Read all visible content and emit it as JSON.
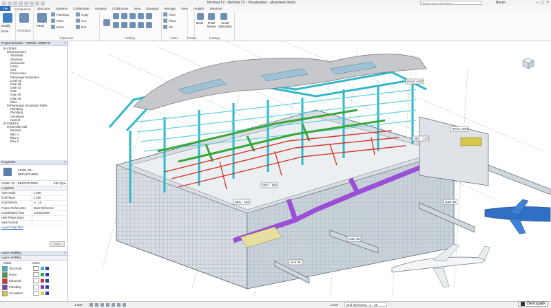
{
  "window": {
    "title": "Terminal T2 - Mumbai T2 - Visualization - (Autodesk Revit)",
    "search_placeholder": "Search and in Formation",
    "user": "Baven"
  },
  "ribbon_tabs": [
    "File",
    "Architecture",
    "Structure",
    "Systems",
    "Collaborate",
    "Analysis",
    "Collaborate",
    "View",
    "Dimapps",
    "Manage",
    "View",
    "Analytic",
    "Measure"
  ],
  "ribbon": {
    "select": {
      "label": "Select",
      "big": "Modify",
      "mode": "None"
    },
    "animation": "Animation",
    "clipboard": {
      "label": "Clipboard",
      "paste": "Paste",
      "items": [
        "Flamingo",
        "Parts",
        "Move"
      ],
      "items2": [
        "Copy",
        "Cut",
        "Exit"
      ]
    },
    "editing": {
      "label": "Editing"
    },
    "video": {
      "label": "Video",
      "items": [
        "View",
        "Place",
        "3D"
      ]
    },
    "relate": {
      "label": "Relate"
    },
    "catalog": {
      "label": "Catalog",
      "items": [
        "Mode",
        "Flash Resize",
        "Smart Maintenity"
      ]
    }
  },
  "project_browser": {
    "title": "Project Browser - VIEWS, SHEETS",
    "nodes": [
      {
        "text": "VIEWS",
        "indent": 1
      },
      {
        "text": "Concourses",
        "indent": 2
      },
      {
        "text": "Structural",
        "indent": 3
      },
      {
        "text": "Structure",
        "indent": 3
      },
      {
        "text": "Concourse",
        "indent": 3
      },
      {
        "text": "HVAC",
        "indent": 3
      },
      {
        "text": "NST",
        "indent": 3
      },
      {
        "text": "Concourses",
        "indent": 3
      },
      {
        "text": "Passenger Movement",
        "indent": 3
      },
      {
        "text": "Level 02",
        "indent": 3
      },
      {
        "text": "Gate 45",
        "indent": 3
      },
      {
        "text": "Gate 43",
        "indent": 3
      },
      {
        "text": "Gate",
        "indent": 3
      },
      {
        "text": "Gate 45",
        "indent": 3
      },
      {
        "text": "Gate 45",
        "indent": 3
      },
      {
        "text": "Pass",
        "indent": 3
      },
      {
        "text": "Passenger Movement Paths",
        "indent": 2
      },
      {
        "text": "Plumbing",
        "indent": 3
      },
      {
        "text": "Plumbing",
        "indent": 3
      },
      {
        "text": "Circulation",
        "indent": 3
      },
      {
        "text": "Current",
        "indent": 3
      },
      {
        "text": "SHEETS",
        "indent": 1
      },
      {
        "text": "Checkin Hall",
        "indent": 2
      },
      {
        "text": "Borneat",
        "indent": 3
      },
      {
        "text": "Bato 1",
        "indent": 3
      },
      {
        "text": "Elev 2",
        "indent": 3
      },
      {
        "text": "Elev 3",
        "indent": 3
      }
    ]
  },
  "properties": {
    "title": "Properties",
    "type_line1": "LEVEL 02 -",
    "type_line2": "DEPARTURES",
    "instance": "LEVEL 02 - DEPARTURES",
    "edit_type": "Edit Type",
    "section": "Legalities",
    "rows": [
      {
        "k": "View Scale",
        "v": "1:200"
      },
      {
        "k": "Grid Ratus",
        "v": "1:200"
      },
      {
        "k": "Grid Referar",
        "v": "A - 18"
      },
      {
        "k": "Project Referenzes",
        "v": "Dont Reference"
      },
      {
        "k": "Coordinated View",
        "v": "Construction"
      },
      {
        "k": "Hide Phase Dues",
        "v": ""
      },
      {
        "k": "View Society",
        "v": ""
      }
    ],
    "help": "Layout Help 3fes",
    "apply": "Apply"
  },
  "layer_visibility": {
    "title1": "Layer Visibility",
    "title2": "Layer Visibility",
    "col_name": "Visible",
    "col_active": "Active",
    "layers": [
      {
        "name": "Structural",
        "color": "#33b5c8"
      },
      {
        "name": "HVAC",
        "color": "#3fa14a"
      },
      {
        "name": "Electrical",
        "color": "#d2342e"
      },
      {
        "name": "Plumbing",
        "color": "#7b3fb5"
      },
      {
        "name": "Circulation",
        "color": "#d9cc4a"
      }
    ]
  },
  "canvas": {
    "labels": [
      "HVAC UNIT",
      "HVAC UNIT",
      "SEC - 103",
      "SEC - 103",
      "SEC - 103",
      "Gate 45",
      "Gate 45",
      "Arch 45"
    ]
  },
  "status": {
    "scale": "1:200",
    "level": "Level",
    "grid_reference": "Grid Reference - A - 18"
  },
  "watermark": "Gemspark",
  "colors": {
    "structure": "#3cc3d3",
    "hvac": "#3faa3f",
    "electrical": "#d23c2c",
    "circulation": "#9b4fd6",
    "glass": "#9fb6c4"
  }
}
